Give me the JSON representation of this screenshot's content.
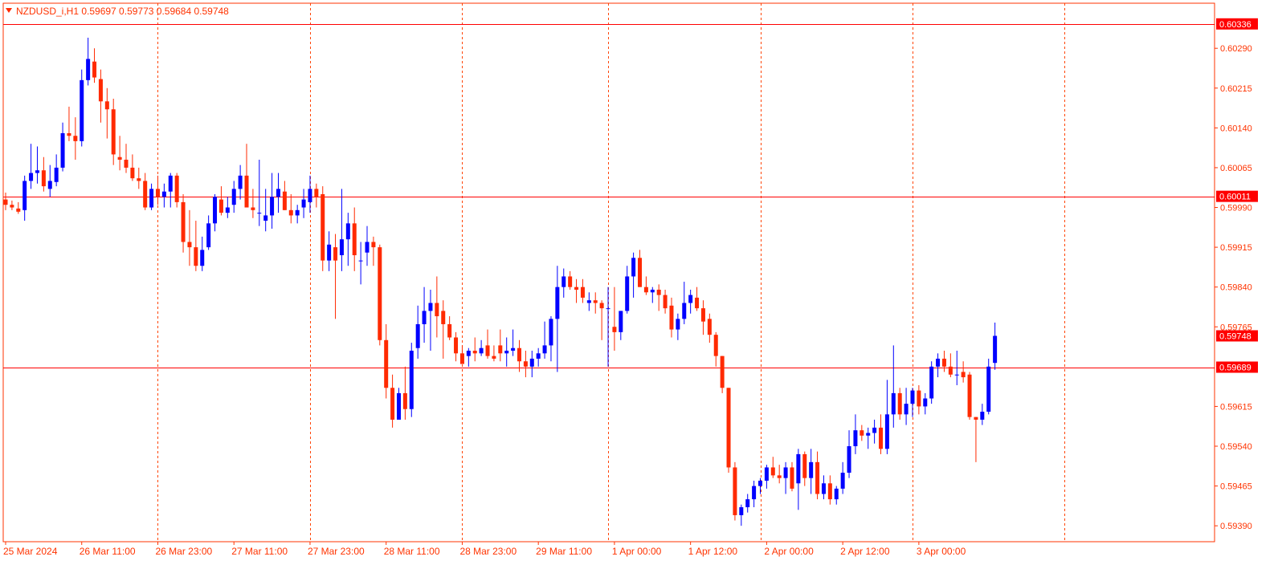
{
  "header": {
    "symbol": "NZDUSD_i,H1",
    "open": "0.59697",
    "high": "0.59773",
    "low": "0.59684",
    "close": "0.59748",
    "icon": "triangle-down-icon"
  },
  "colors": {
    "bull": "#0000ff",
    "bear": "#ff2a00",
    "axis": "#ff3300",
    "grid": "#ff4400",
    "hline": "#ff0000",
    "label_bg": "#ff0000",
    "label_text": "#ffffff",
    "background": "#ffffff"
  },
  "chart_data": {
    "type": "candlestick",
    "y_axis": {
      "range": [
        0.5936,
        0.60375
      ],
      "ticks": [
        "0.60290",
        "0.60215",
        "0.60140",
        "0.60065",
        "0.59990",
        "0.59915",
        "0.59840",
        "0.59765",
        "0.59615",
        "0.59540",
        "0.59465",
        "0.59390"
      ]
    },
    "x_axis": {
      "labels": [
        "25 Mar 2024",
        "26 Mar 11:00",
        "26 Mar 23:00",
        "27 Mar 11:00",
        "27 Mar 23:00",
        "28 Mar 11:00",
        "28 Mar 23:00",
        "29 Mar 11:00",
        "1 Apr 00:00",
        "1 Apr 12:00",
        "2 Apr 00:00",
        "2 Apr 12:00",
        "3 Apr 00:00"
      ],
      "label_bars": [
        0,
        12,
        24,
        36,
        48,
        60,
        72,
        84,
        96,
        108,
        120,
        132,
        144
      ]
    },
    "grid": "vertical-dashed",
    "horizontal_lines": [
      "0.60336",
      "0.60011",
      "0.59689"
    ],
    "price_labels": [
      "0.60336",
      "0.60011",
      "0.59748",
      "0.59689"
    ],
    "current_price": "0.59748",
    "ohlc": [
      [
        0.60005,
        0.60018,
        0.59985,
        0.59995
      ],
      [
        0.59995,
        0.60003,
        0.59985,
        0.5999
      ],
      [
        0.59988,
        0.6,
        0.59978,
        0.59982
      ],
      [
        0.59985,
        0.6005,
        0.59965,
        0.6004
      ],
      [
        0.6004,
        0.6011,
        0.60025,
        0.60055
      ],
      [
        0.60055,
        0.60105,
        0.60035,
        0.6006
      ],
      [
        0.6006,
        0.60085,
        0.6002,
        0.6003
      ],
      [
        0.60025,
        0.6007,
        0.6001,
        0.6004
      ],
      [
        0.60038,
        0.6009,
        0.6003,
        0.60065
      ],
      [
        0.60065,
        0.6015,
        0.60058,
        0.6013
      ],
      [
        0.6013,
        0.6018,
        0.60115,
        0.60125
      ],
      [
        0.60125,
        0.6016,
        0.6008,
        0.60115
      ],
      [
        0.60115,
        0.6025,
        0.60105,
        0.6023
      ],
      [
        0.6023,
        0.6031,
        0.6022,
        0.6027
      ],
      [
        0.60265,
        0.6029,
        0.60225,
        0.60235
      ],
      [
        0.60232,
        0.6025,
        0.6015,
        0.6019
      ],
      [
        0.6019,
        0.60215,
        0.6012,
        0.60175
      ],
      [
        0.60175,
        0.60195,
        0.6007,
        0.6009
      ],
      [
        0.60085,
        0.60125,
        0.6006,
        0.6008
      ],
      [
        0.6008,
        0.6011,
        0.60055,
        0.60065
      ],
      [
        0.60065,
        0.6009,
        0.6004,
        0.60045
      ],
      [
        0.60045,
        0.60065,
        0.60025,
        0.6004
      ],
      [
        0.6004,
        0.60055,
        0.59985,
        0.5999
      ],
      [
        0.5999,
        0.60035,
        0.59985,
        0.60025
      ],
      [
        0.60025,
        0.6005,
        0.59995,
        0.6001
      ],
      [
        0.6001,
        0.60035,
        0.5999,
        0.6002
      ],
      [
        0.6002,
        0.60055,
        0.5999,
        0.6005
      ],
      [
        0.6005,
        0.60055,
        0.5999,
        0.6
      ],
      [
        0.6,
        0.60015,
        0.59905,
        0.59925
      ],
      [
        0.59925,
        0.59985,
        0.5988,
        0.59915
      ],
      [
        0.59915,
        0.59965,
        0.5987,
        0.5988
      ],
      [
        0.5988,
        0.59935,
        0.5987,
        0.5991
      ],
      [
        0.59915,
        0.59975,
        0.5991,
        0.5996
      ],
      [
        0.5996,
        0.60015,
        0.59945,
        0.6001
      ],
      [
        0.60005,
        0.6003,
        0.59975,
        0.5998
      ],
      [
        0.5998,
        0.6001,
        0.5997,
        0.5999
      ],
      [
        0.59995,
        0.6004,
        0.5998,
        0.60025
      ],
      [
        0.60025,
        0.6007,
        0.60005,
        0.6005
      ],
      [
        0.6005,
        0.6011,
        0.59995,
        0.5999
      ],
      [
        0.5999,
        0.60025,
        0.5997,
        0.59985
      ],
      [
        0.5998,
        0.6008,
        0.59955,
        0.5998
      ],
      [
        0.59965,
        0.60025,
        0.59945,
        0.59975
      ],
      [
        0.59975,
        0.60055,
        0.5995,
        0.6001
      ],
      [
        0.6001,
        0.60055,
        0.5998,
        0.60025
      ],
      [
        0.6002,
        0.6004,
        0.5999,
        0.59985
      ],
      [
        0.59985,
        0.60015,
        0.5996,
        0.59975
      ],
      [
        0.59975,
        0.59995,
        0.5996,
        0.59985
      ],
      [
        0.5999,
        0.60025,
        0.5997,
        0.60005
      ],
      [
        0.6,
        0.6005,
        0.5998,
        0.60025
      ],
      [
        0.60025,
        0.60035,
        0.5999,
        0.6001
      ],
      [
        0.60015,
        0.6003,
        0.5987,
        0.5989
      ],
      [
        0.5989,
        0.59945,
        0.5987,
        0.5992
      ],
      [
        0.59915,
        0.5994,
        0.5978,
        0.5989
      ],
      [
        0.599,
        0.60025,
        0.5987,
        0.5993
      ],
      [
        0.5993,
        0.5998,
        0.5988,
        0.5996
      ],
      [
        0.5996,
        0.5999,
        0.5987,
        0.599
      ],
      [
        0.5989,
        0.59925,
        0.59845,
        0.5989
      ],
      [
        0.59905,
        0.59955,
        0.5988,
        0.59925
      ],
      [
        0.59925,
        0.59935,
        0.5988,
        0.59915
      ],
      [
        0.59915,
        0.5992,
        0.5973,
        0.5974
      ],
      [
        0.5974,
        0.5977,
        0.5963,
        0.5965
      ],
      [
        0.5965,
        0.59675,
        0.59575,
        0.5959
      ],
      [
        0.5959,
        0.5965,
        0.5959,
        0.5964
      ],
      [
        0.5964,
        0.5969,
        0.5959,
        0.5961
      ],
      [
        0.5961,
        0.59735,
        0.59595,
        0.5972
      ],
      [
        0.59725,
        0.59805,
        0.59705,
        0.5977
      ],
      [
        0.5977,
        0.5984,
        0.59735,
        0.59795
      ],
      [
        0.59795,
        0.59835,
        0.5972,
        0.5981
      ],
      [
        0.5981,
        0.5986,
        0.59745,
        0.59785
      ],
      [
        0.59795,
        0.59815,
        0.59705,
        0.5977
      ],
      [
        0.5977,
        0.59785,
        0.5974,
        0.59745
      ],
      [
        0.59745,
        0.59755,
        0.597,
        0.59715
      ],
      [
        0.59715,
        0.5973,
        0.59705,
        0.59695
      ],
      [
        0.5971,
        0.59725,
        0.5969,
        0.5972
      ],
      [
        0.5972,
        0.59745,
        0.597,
        0.59715
      ],
      [
        0.59715,
        0.5974,
        0.5971,
        0.59725
      ],
      [
        0.5973,
        0.5976,
        0.59705,
        0.5971
      ],
      [
        0.5971,
        0.5973,
        0.597,
        0.59705
      ],
      [
        0.5973,
        0.5976,
        0.597,
        0.59715
      ],
      [
        0.59715,
        0.59745,
        0.5969,
        0.5972
      ],
      [
        0.5972,
        0.5976,
        0.5971,
        0.59725
      ],
      [
        0.59725,
        0.5974,
        0.5968,
        0.597
      ],
      [
        0.597,
        0.5972,
        0.5967,
        0.5969
      ],
      [
        0.5969,
        0.5972,
        0.5967,
        0.59705
      ],
      [
        0.59705,
        0.59725,
        0.5969,
        0.59715
      ],
      [
        0.59715,
        0.59775,
        0.59705,
        0.5973
      ],
      [
        0.5973,
        0.59785,
        0.597,
        0.5978
      ],
      [
        0.5978,
        0.5988,
        0.5968,
        0.5984
      ],
      [
        0.5984,
        0.59875,
        0.5982,
        0.5986
      ],
      [
        0.5986,
        0.5987,
        0.59835,
        0.5984
      ],
      [
        0.5984,
        0.59855,
        0.5981,
        0.59835
      ],
      [
        0.5984,
        0.59855,
        0.5981,
        0.5982
      ],
      [
        0.5981,
        0.5983,
        0.59795,
        0.59815
      ],
      [
        0.59815,
        0.5983,
        0.5979,
        0.5981
      ],
      [
        0.5981,
        0.59815,
        0.5974,
        0.598
      ],
      [
        0.598,
        0.5984,
        0.5969,
        0.598
      ],
      [
        0.59765,
        0.5984,
        0.5972,
        0.59755
      ],
      [
        0.59755,
        0.59785,
        0.5974,
        0.59795
      ],
      [
        0.59795,
        0.5988,
        0.5979,
        0.5986
      ],
      [
        0.5986,
        0.59905,
        0.5982,
        0.59895
      ],
      [
        0.59895,
        0.5991,
        0.59845,
        0.5984
      ],
      [
        0.5984,
        0.5986,
        0.59825,
        0.5983
      ],
      [
        0.5983,
        0.5984,
        0.5981,
        0.59835
      ],
      [
        0.59835,
        0.59845,
        0.59795,
        0.59825
      ],
      [
        0.59825,
        0.59835,
        0.5979,
        0.598
      ],
      [
        0.59805,
        0.5982,
        0.59745,
        0.5976
      ],
      [
        0.5976,
        0.5979,
        0.5974,
        0.5978
      ],
      [
        0.5978,
        0.5985,
        0.5977,
        0.5981
      ],
      [
        0.5981,
        0.59835,
        0.5979,
        0.59825
      ],
      [
        0.5982,
        0.5984,
        0.59795,
        0.598
      ],
      [
        0.598,
        0.59815,
        0.5975,
        0.59775
      ],
      [
        0.5978,
        0.5979,
        0.59735,
        0.5975
      ],
      [
        0.5975,
        0.59755,
        0.5969,
        0.5971
      ],
      [
        0.5971,
        0.597,
        0.5964,
        0.5965
      ],
      [
        0.5965,
        0.5963,
        0.5949,
        0.595
      ],
      [
        0.595,
        0.5951,
        0.594,
        0.5941
      ],
      [
        0.5941,
        0.5943,
        0.5939,
        0.59425
      ],
      [
        0.59425,
        0.5945,
        0.59415,
        0.5944
      ],
      [
        0.5944,
        0.59475,
        0.59425,
        0.59465
      ],
      [
        0.59465,
        0.5948,
        0.5945,
        0.59475
      ],
      [
        0.59475,
        0.59505,
        0.5946,
        0.595
      ],
      [
        0.595,
        0.5952,
        0.5948,
        0.59485
      ],
      [
        0.59485,
        0.59505,
        0.5947,
        0.5948
      ],
      [
        0.5948,
        0.5951,
        0.5945,
        0.595
      ],
      [
        0.595,
        0.5951,
        0.59455,
        0.5946
      ],
      [
        0.5947,
        0.59535,
        0.5942,
        0.59525
      ],
      [
        0.59525,
        0.5953,
        0.59465,
        0.5948
      ],
      [
        0.5948,
        0.59535,
        0.5945,
        0.5951
      ],
      [
        0.5951,
        0.5953,
        0.5944,
        0.5945
      ],
      [
        0.5945,
        0.59485,
        0.5944,
        0.5947
      ],
      [
        0.5947,
        0.59485,
        0.5943,
        0.5944
      ],
      [
        0.5944,
        0.59465,
        0.5943,
        0.5946
      ],
      [
        0.5946,
        0.5951,
        0.5945,
        0.5949
      ],
      [
        0.5949,
        0.5957,
        0.5948,
        0.5954
      ],
      [
        0.5954,
        0.596,
        0.59525,
        0.5957
      ],
      [
        0.5957,
        0.5958,
        0.5955,
        0.5956
      ],
      [
        0.5956,
        0.59575,
        0.59535,
        0.59565
      ],
      [
        0.59565,
        0.5959,
        0.59545,
        0.59575
      ],
      [
        0.59575,
        0.596,
        0.59525,
        0.59535
      ],
      [
        0.59535,
        0.59665,
        0.59525,
        0.596
      ],
      [
        0.596,
        0.5973,
        0.59575,
        0.5964
      ],
      [
        0.5964,
        0.5965,
        0.5959,
        0.596
      ],
      [
        0.596,
        0.5965,
        0.5958,
        0.5962
      ],
      [
        0.5962,
        0.5965,
        0.59595,
        0.59645
      ],
      [
        0.59645,
        0.59655,
        0.596,
        0.59615
      ],
      [
        0.59615,
        0.5964,
        0.596,
        0.5963
      ],
      [
        0.5963,
        0.597,
        0.5962,
        0.5969
      ],
      [
        0.5969,
        0.59715,
        0.5967,
        0.59705
      ],
      [
        0.59705,
        0.5972,
        0.5968,
        0.5969
      ],
      [
        0.5969,
        0.59715,
        0.5967,
        0.59675
      ],
      [
        0.59675,
        0.5972,
        0.59655,
        0.59675
      ],
      [
        0.5968,
        0.597,
        0.5966,
        0.5967
      ],
      [
        0.59675,
        0.5968,
        0.5959,
        0.59595
      ],
      [
        0.59595,
        0.59595,
        0.5951,
        0.5959
      ],
      [
        0.5959,
        0.5962,
        0.5958,
        0.59605
      ],
      [
        0.59605,
        0.59705,
        0.596,
        0.5969
      ],
      [
        0.59697,
        0.59773,
        0.59684,
        0.59748
      ]
    ]
  }
}
